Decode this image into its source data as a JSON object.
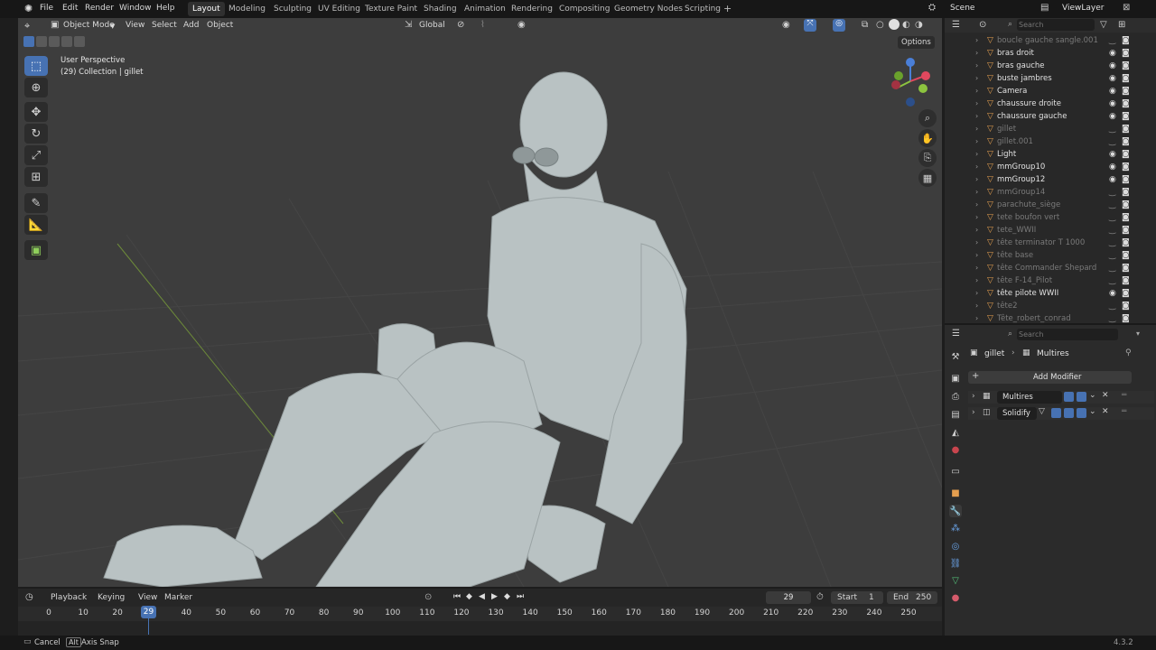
{
  "topbar": {
    "menus": [
      "File",
      "Edit",
      "Render",
      "Window",
      "Help"
    ],
    "workspaces": [
      "Layout",
      "Modeling",
      "Sculpting",
      "UV Editing",
      "Texture Paint",
      "Shading",
      "Animation",
      "Rendering",
      "Compositing",
      "Geometry Nodes",
      "Scripting"
    ],
    "active_workspace": "Layout",
    "scene": "Scene",
    "view_layer": "ViewLayer"
  },
  "viewport_header": {
    "mode": "Object Mode",
    "menus": [
      "View",
      "Select",
      "Add",
      "Object"
    ],
    "transform_orientation": "Global",
    "options_label": "Options"
  },
  "viewport": {
    "perspective_label": "User Perspective",
    "collection_label": "(29) Collection | gillet"
  },
  "outliner": {
    "search_placeholder": "Search",
    "items": [
      {
        "name": "boucle gauche sangle.001",
        "dim": true
      },
      {
        "name": "bras droit",
        "dim": false
      },
      {
        "name": "bras gauche",
        "dim": false
      },
      {
        "name": "buste jambres",
        "dim": false
      },
      {
        "name": "Camera",
        "dim": false
      },
      {
        "name": "chaussure droite",
        "dim": false
      },
      {
        "name": "chaussure gauche",
        "dim": false
      },
      {
        "name": "gillet",
        "dim": true
      },
      {
        "name": "gillet.001",
        "dim": true
      },
      {
        "name": "Light",
        "dim": false
      },
      {
        "name": "mmGroup10",
        "dim": false
      },
      {
        "name": "mmGroup12",
        "dim": false
      },
      {
        "name": "mmGroup14",
        "dim": true
      },
      {
        "name": "parachute_siège",
        "dim": true
      },
      {
        "name": "tete boufon vert",
        "dim": true
      },
      {
        "name": "tete_WWII",
        "dim": true
      },
      {
        "name": "tête  terminator T 1000",
        "dim": true
      },
      {
        "name": "tête base",
        "dim": true
      },
      {
        "name": "tête Commander Shepard",
        "dim": true
      },
      {
        "name": "tête F-14_Pilot",
        "dim": true
      },
      {
        "name": "tête pilote WWII",
        "dim": false
      },
      {
        "name": "tête2",
        "dim": true
      },
      {
        "name": "Tête_robert_conrad",
        "dim": true
      }
    ]
  },
  "properties": {
    "search_placeholder": "Search",
    "breadcrumb_object": "gillet",
    "breadcrumb_modifier": "Multires",
    "add_modifier_label": "Add Modifier",
    "modifiers": [
      "Multires",
      "Solidify"
    ]
  },
  "timeline": {
    "menus": [
      "Playback",
      "Keying",
      "View",
      "Marker"
    ],
    "current_frame": "29",
    "start_label": "Start",
    "start": "1",
    "end_label": "End",
    "end": "250",
    "ticks": [
      "0",
      "10",
      "20",
      "29",
      "40",
      "50",
      "60",
      "70",
      "80",
      "90",
      "100",
      "110",
      "120",
      "130",
      "140",
      "150",
      "160",
      "170",
      "180",
      "190",
      "200",
      "210",
      "220",
      "230",
      "240",
      "250"
    ]
  },
  "statusbar": {
    "cancel": "Cancel",
    "key_hint": "Alt",
    "axis_snap": "Axis Snap",
    "version": "4.3.2"
  },
  "colors": {
    "accent": "#4772b3",
    "mesh_icon": "#e49e4f",
    "vertex_group": "#54c07a"
  }
}
